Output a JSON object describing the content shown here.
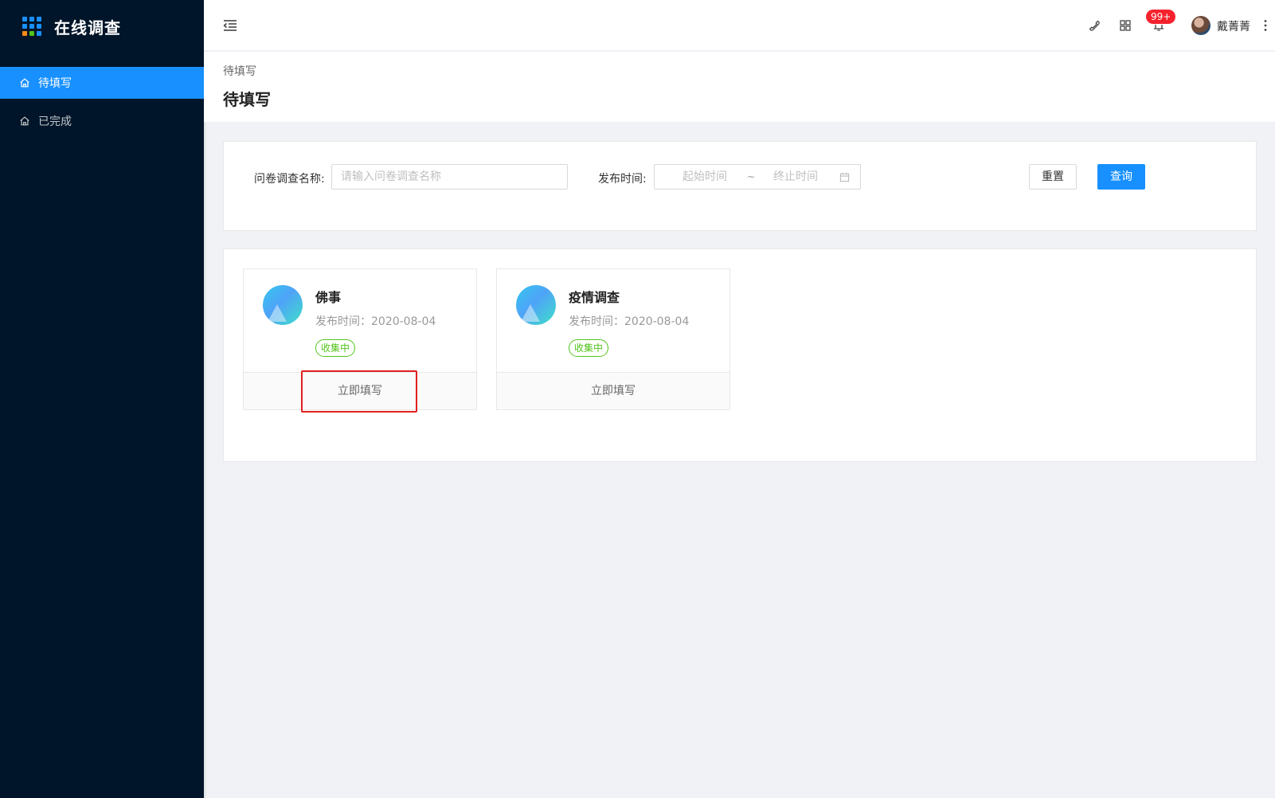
{
  "app": {
    "title": "在线调查"
  },
  "sidebar": {
    "items": [
      {
        "label": "待填写",
        "icon": "home-icon",
        "active": true
      },
      {
        "label": "已完成",
        "icon": "home-icon",
        "active": false
      }
    ]
  },
  "header": {
    "notification_badge": "99+",
    "user_name": "戴菁菁",
    "icons": [
      "phone-icon",
      "apps-icon",
      "bell-icon",
      "more-vertical-icon"
    ]
  },
  "page": {
    "breadcrumb": "待填写",
    "title": "待填写"
  },
  "search": {
    "name_label": "问卷调查名称:",
    "name_placeholder": "请输入问卷调查名称",
    "time_label": "发布时间:",
    "start_placeholder": "起始时间",
    "range_separator": "~",
    "end_placeholder": "终止时间",
    "reset_label": "重置",
    "query_label": "查询"
  },
  "surveys": [
    {
      "title": "佛事",
      "meta": "发布时间：2020-08-04",
      "status": "收集中",
      "action": "立即填写"
    },
    {
      "title": "疫情调查",
      "meta": "发布时间：2020-08-04",
      "status": "收集中",
      "action": "立即填写"
    }
  ],
  "colors": {
    "sidebar_bg": "#001529",
    "primary": "#1890ff",
    "status_green": "#52c41a",
    "badge_red": "#f5222d",
    "highlight_red": "#e02020"
  }
}
